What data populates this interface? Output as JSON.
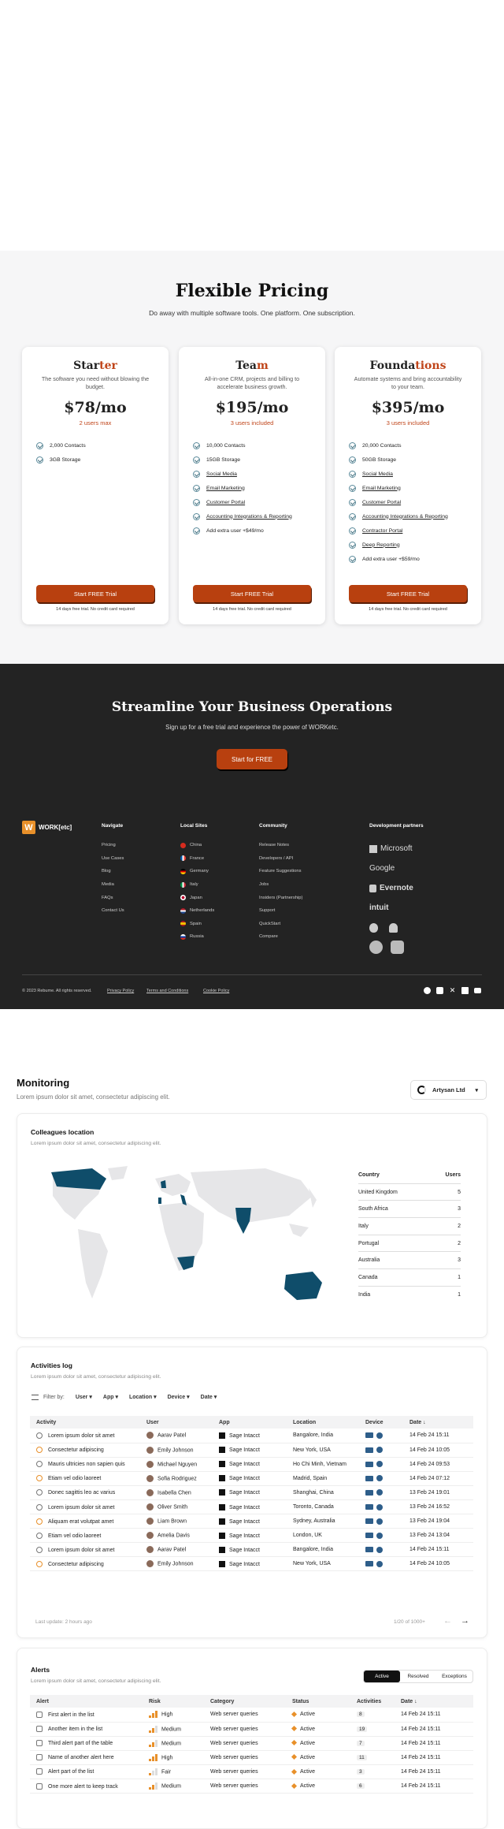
{
  "pricing": {
    "title": "Flexible Pricing",
    "subtitle": "Do away with multiple software tools. One platform. One subscription.",
    "plans": [
      {
        "name_a": "Star",
        "name_b": "ter",
        "desc": "The software you need without blowing the budget.",
        "price": "$78/mo",
        "users": "2 users max",
        "features": [
          "2,000 Contacts",
          "3GB Storage"
        ],
        "cta": "Start FREE Trial",
        "note": "14 days free trial. No credit card required"
      },
      {
        "name_a": "Tea",
        "name_b": "m",
        "desc": "All-in-one CRM, projects and billing to accelerate business growth.",
        "price": "$195/mo",
        "users": "3 users included",
        "features": [
          "10,000 Contacts",
          "15GB Storage",
          "Social Media",
          "Email Marketing",
          "Customer Portal",
          "Accounting Integrations & Reporting",
          "Add extra user +$49/mo"
        ],
        "cta": "Start FREE Trial",
        "note": "14 days free trial. No credit card required"
      },
      {
        "name_a": "Founda",
        "name_b": "tions",
        "desc": "Automate systems and bring accountability to your team.",
        "price": "$395/mo",
        "users": "3 users included",
        "features": [
          "20,000 Contacts",
          "50GB Storage",
          "Social Media",
          "Email Marketing",
          "Customer Portal",
          "Accounting Integrations & Reporting",
          "Contractor Portal",
          "Deep Reporting",
          "Add extra user +$59/mo"
        ],
        "cta": "Start FREE Trial",
        "note": "14 days free trial. No credit card required"
      }
    ]
  },
  "footer": {
    "title": "Streamline Your Business Operations",
    "subtitle": "Sign up for a free trial and experience the power of WORKetc.",
    "cta": "Start for FREE",
    "logo_mark": "W",
    "logo_text": "WORK[etc]",
    "navigate": {
      "title": "Navigate",
      "items": [
        "Pricing",
        "Use Cases",
        "Blog",
        "Media",
        "FAQs",
        "Contact Us"
      ]
    },
    "sites": {
      "title": "Local Sites",
      "items": [
        "China",
        "France",
        "Germany",
        "Italy",
        "Japan",
        "Netherlands",
        "Spain",
        "Russia"
      ]
    },
    "community": {
      "title": "Community",
      "items": [
        "Release Notes",
        "Developers / API",
        "Feature Suggestions",
        "Jobs",
        "Insiders (Partnership)",
        "Support",
        "QuickStart",
        "Compare"
      ]
    },
    "partners": {
      "title": "Development partners",
      "items": [
        "Microsoft",
        "Google",
        "Evernote",
        "intuit"
      ]
    },
    "copyright": "© 2023 Rebume. All rights reserved.",
    "links": [
      "Privacy Policy",
      "Terms and Conditions",
      "Cookie Policy"
    ]
  },
  "monitor": {
    "title": "Monitoring",
    "subtitle": "Lorem ipsum dolor sit amet, consectetur adipiscing elit.",
    "org": "Artysan Ltd",
    "location": {
      "title": "Colleagues location",
      "desc": "Lorem ipsum dolor sit amet, consectetur adipiscing elit.",
      "h_country": "Country",
      "h_users": "Users",
      "rows": [
        [
          "United Kingdom",
          "5"
        ],
        [
          "South Africa",
          "3"
        ],
        [
          "Italy",
          "2"
        ],
        [
          "Portugal",
          "2"
        ],
        [
          "Australia",
          "3"
        ],
        [
          "Canada",
          "1"
        ],
        [
          "India",
          "1"
        ]
      ]
    },
    "activities": {
      "title": "Activities log",
      "desc": "Lorem ipsum dolor sit amet, consectetur adipiscing elit.",
      "filter_label": "Filter by:",
      "filters": [
        "User",
        "App",
        "Location",
        "Device",
        "Date"
      ],
      "headers": [
        "Activity",
        "User",
        "App",
        "Location",
        "Device",
        "Date"
      ],
      "rows": [
        [
          "Lorem ipsum dolor sit amet",
          "Aarav Patel",
          "Sage Intacct",
          "Bangalore, India",
          "14 Feb 24  15:11"
        ],
        [
          "Consectetur adipiscing",
          "Emily Johnson",
          "Sage Intacct",
          "New York, USA",
          "14 Feb 24  10:05"
        ],
        [
          "Mauris ultricies non sapien quis",
          "Michael Nguyen",
          "Sage Intacct",
          "Ho Chi Minh, Vietnam",
          "14 Feb 24  09:53"
        ],
        [
          "Etiam vel odio laoreet",
          "Sofia Rodriguez",
          "Sage Intacct",
          "Madrid, Spain",
          "14 Feb 24  07:12"
        ],
        [
          "Donec sagittis leo ac varius",
          "Isabella Chen",
          "Sage Intacct",
          "Shanghai, China",
          "13 Feb 24  19:01"
        ],
        [
          "Lorem ipsum dolor sit amet",
          "Oliver Smith",
          "Sage Intacct",
          "Toronto, Canada",
          "13 Feb 24  16:52"
        ],
        [
          "Aliquam erat volutpat amet",
          "Liam Brown",
          "Sage Intacct",
          "Sydney, Australia",
          "13 Feb 24  19:04"
        ],
        [
          "Etiam vel odio laoreet",
          "Amelia Davis",
          "Sage Intacct",
          "London, UK",
          "13 Feb 24  13:04"
        ],
        [
          "Lorem ipsum dolor sit amet",
          "Aarav Patel",
          "Sage Intacct",
          "Bangalore, India",
          "14 Feb 24  15:11"
        ],
        [
          "Consectetur adipiscing",
          "Emily Johnson",
          "Sage Intacct",
          "New York, USA",
          "14 Feb 24  10:05"
        ]
      ],
      "last_update": "Last update: 2 hours ago",
      "pagination": "1/20 of 1000+"
    },
    "alerts": {
      "title": "Alerts",
      "desc": "Lorem ipsum dolor sit amet, consectetur adipiscing elit.",
      "tabs": [
        "Active",
        "Resolved",
        "Exceptions"
      ],
      "headers": [
        "Alert",
        "Risk",
        "Category",
        "Status",
        "Activities",
        "Date"
      ],
      "rows": [
        [
          "First alert in the list",
          "High",
          "Web server queries",
          "Active",
          "8",
          "14 Feb 24  15:11"
        ],
        [
          "Another item in the list",
          "Medium",
          "Web server queries",
          "Active",
          "19",
          "14 Feb 24  15:11"
        ],
        [
          "Third alert part of the table",
          "Medium",
          "Web server queries",
          "Active",
          "7",
          "14 Feb 24  15:11"
        ],
        [
          "Name of another alert here",
          "High",
          "Web server queries",
          "Active",
          "11",
          "14 Feb 24  15:11"
        ],
        [
          "Alert part of the list",
          "Fair",
          "Web server queries",
          "Active",
          "3",
          "14 Feb 24  15:11"
        ],
        [
          "One more alert to keep track",
          "Medium",
          "Web server queries",
          "Active",
          "6",
          "14 Feb 24  15:11"
        ]
      ]
    }
  }
}
